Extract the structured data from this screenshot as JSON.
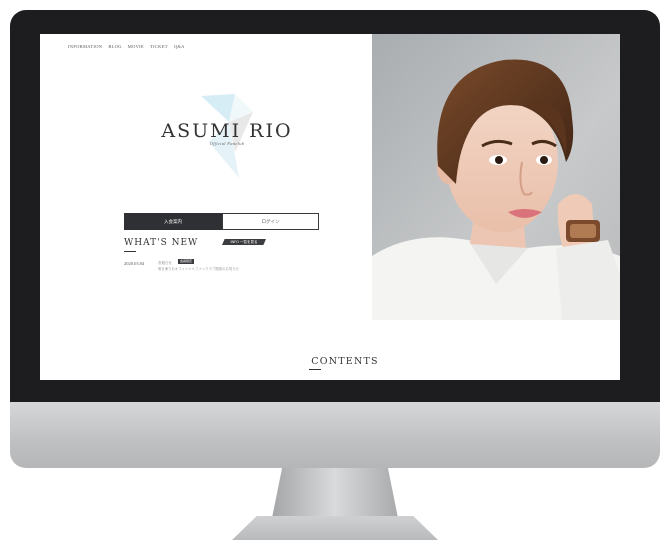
{
  "nav": {
    "items": [
      "INFORMATION",
      "BLOG",
      "MOVIE",
      "TICKET",
      "Q&A"
    ]
  },
  "logo": {
    "title": "ASUMI RIO",
    "subtitle": "Official Fanclub"
  },
  "buttons": {
    "join_label": "入会案内",
    "login_label": "ログイン"
  },
  "news": {
    "heading": "WHAT'S NEW",
    "more_label": "INFO 一覧を見る",
    "items": [
      {
        "date": "2020.03.04",
        "category": "お知らせ",
        "badge": "会員限定",
        "headline": "明日海りおオフィシャルファンクラブ開設のお知らせ"
      }
    ]
  },
  "contents": {
    "heading": "CONTENTS"
  },
  "colors": {
    "dark": "#2f3033",
    "logo_accent": "#d9eef6",
    "bezel": "#1d1d1f",
    "chin": "#c4c5c7"
  }
}
